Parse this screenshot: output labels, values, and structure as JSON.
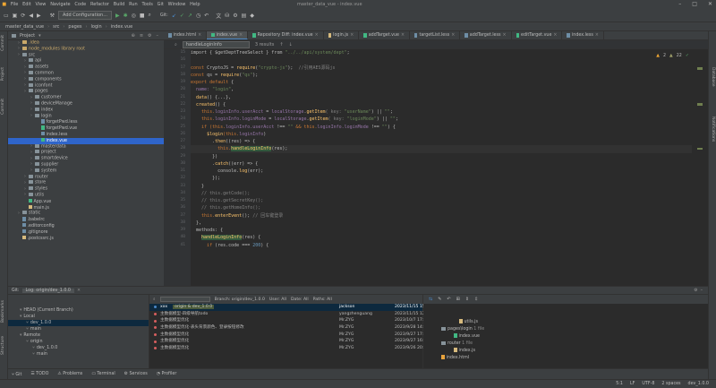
{
  "menu": [
    "File",
    "Edit",
    "View",
    "Navigate",
    "Code",
    "Refactor",
    "Build",
    "Run",
    "Tools",
    "Git",
    "Window",
    "Help"
  ],
  "window_title": "master_data_vue - index.vue",
  "toolbar": {
    "config_label": "Add Configuration...",
    "git_label": "Git:"
  },
  "breadcrumbs": [
    "master_data_vue",
    "src",
    "pages",
    "login",
    "index.vue"
  ],
  "project": {
    "header": "Project",
    "tree": [
      {
        "label": ".idea",
        "depth": 1,
        "kind": "folder",
        "color": "orange"
      },
      {
        "label": "node_modules library root",
        "depth": 1,
        "kind": "folder",
        "color": "orange"
      },
      {
        "label": "src",
        "depth": 1,
        "kind": "folder"
      },
      {
        "label": "api",
        "depth": 2,
        "kind": "folder"
      },
      {
        "label": "assets",
        "depth": 2,
        "kind": "folder"
      },
      {
        "label": "common",
        "depth": 2,
        "kind": "folder"
      },
      {
        "label": "components",
        "depth": 2,
        "kind": "folder"
      },
      {
        "label": "iconfont",
        "depth": 2,
        "kind": "folder"
      },
      {
        "label": "pages",
        "depth": 2,
        "kind": "folder"
      },
      {
        "label": "customer",
        "depth": 3,
        "kind": "folder"
      },
      {
        "label": "deviceManage",
        "depth": 3,
        "kind": "folder"
      },
      {
        "label": "index",
        "depth": 3,
        "kind": "folder"
      },
      {
        "label": "login",
        "depth": 3,
        "kind": "folder"
      },
      {
        "label": "forgetPwd.less",
        "depth": 4,
        "kind": "file"
      },
      {
        "label": "forgetPwd.vue",
        "depth": 4,
        "kind": "vue"
      },
      {
        "label": "index.less",
        "depth": 4,
        "kind": "file"
      },
      {
        "label": "index.vue",
        "depth": 4,
        "kind": "vue",
        "selected": true
      },
      {
        "label": "masterdata",
        "depth": 3,
        "kind": "folder"
      },
      {
        "label": "project",
        "depth": 3,
        "kind": "folder"
      },
      {
        "label": "smartdevice",
        "depth": 3,
        "kind": "folder"
      },
      {
        "label": "supplier",
        "depth": 3,
        "kind": "folder"
      },
      {
        "label": "system",
        "depth": 3,
        "kind": "folder"
      },
      {
        "label": "router",
        "depth": 2,
        "kind": "folder"
      },
      {
        "label": "store",
        "depth": 2,
        "kind": "folder"
      },
      {
        "label": "styles",
        "depth": 2,
        "kind": "folder"
      },
      {
        "label": "utils",
        "depth": 2,
        "kind": "folder"
      },
      {
        "label": "App.vue",
        "depth": 2,
        "kind": "vue"
      },
      {
        "label": "main.js",
        "depth": 2,
        "kind": "js"
      },
      {
        "label": "static",
        "depth": 1,
        "kind": "folder"
      },
      {
        "label": ".babelrc",
        "depth": 1,
        "kind": "file"
      },
      {
        "label": ".editorconfig",
        "depth": 1,
        "kind": "file"
      },
      {
        "label": ".gitignore",
        "depth": 1,
        "kind": "file"
      },
      {
        "label": ".postcssrc.js",
        "depth": 1,
        "kind": "js"
      }
    ]
  },
  "tabs": [
    {
      "label": "index.html"
    },
    {
      "label": "index.vue",
      "active": true
    },
    {
      "label": "Repository Diff: index.vue"
    },
    {
      "label": "login.js"
    },
    {
      "label": "addTarget.vue"
    },
    {
      "label": "targetList.less"
    },
    {
      "label": "addTarget.less"
    },
    {
      "label": "editTarget.vue"
    },
    {
      "label": "index.less"
    }
  ],
  "subbar": {
    "search": "handleLoginInfo",
    "results": "3 results"
  },
  "inspections": {
    "warnings": "2",
    "weak": "22",
    "ok": "17"
  },
  "code_lines": [
    [
      [
        "import { ",
        "t"
      ],
      [
        "$getDeptTreeSelect",
        "t"
      ],
      [
        " } from ",
        "t"
      ],
      [
        "\"../../api/system/dept\"",
        "s"
      ],
      [
        ";",
        "t"
      ]
    ],
    [],
    [
      [
        "const ",
        "k"
      ],
      [
        "CryptoJS",
        "t"
      ],
      [
        " = ",
        "t"
      ],
      [
        "require",
        "f"
      ],
      [
        "(",
        "t"
      ],
      [
        "\"crypto-js\"",
        "s"
      ],
      [
        ");  ",
        "t"
      ],
      [
        "//引用AES源码js",
        "c"
      ]
    ],
    [
      [
        "const ",
        "k"
      ],
      [
        "qs",
        "t"
      ],
      [
        " = ",
        "t"
      ],
      [
        "require",
        "f"
      ],
      [
        "(",
        "t"
      ],
      [
        "\"qs\"",
        "s"
      ],
      [
        ");",
        "t"
      ]
    ],
    [
      [
        "export default ",
        "k"
      ],
      [
        "{",
        "t"
      ]
    ],
    [
      [
        "  name: ",
        "p"
      ],
      [
        "\"login\"",
        "s"
      ],
      [
        ",",
        "t"
      ]
    ],
    [
      [
        "  ",
        "t"
      ],
      [
        "data",
        "f"
      ],
      [
        "() ",
        "t"
      ],
      [
        "{...}",
        "t"
      ],
      [
        ",",
        "t"
      ]
    ],
    [
      [
        "  ",
        "t"
      ],
      [
        "created",
        "f"
      ],
      [
        "() {",
        "t"
      ]
    ],
    [
      [
        "    this.",
        "k"
      ],
      [
        "loginInfo.userAcct",
        "p"
      ],
      [
        " = ",
        "t"
      ],
      [
        "localStorage",
        "p"
      ],
      [
        ".",
        "t"
      ],
      [
        "getItem",
        "f"
      ],
      [
        "( key: ",
        "c"
      ],
      [
        "\"userName\"",
        "s"
      ],
      [
        ") || ",
        "t"
      ],
      [
        "\"\"",
        "s"
      ],
      [
        ";",
        "t"
      ]
    ],
    [
      [
        "    this.",
        "k"
      ],
      [
        "loginInfo.loginMode",
        "p"
      ],
      [
        " = ",
        "t"
      ],
      [
        "localStorage",
        "p"
      ],
      [
        ".",
        "t"
      ],
      [
        "getItem",
        "f"
      ],
      [
        "( key: ",
        "c"
      ],
      [
        "\"loginMode\"",
        "s"
      ],
      [
        ") || ",
        "t"
      ],
      [
        "\"\"",
        "s"
      ],
      [
        ";",
        "t"
      ]
    ],
    [
      [
        "    if ",
        "k"
      ],
      [
        "(this.",
        "k"
      ],
      [
        "loginInfo.userAcct",
        "p"
      ],
      [
        " !== ",
        "t"
      ],
      [
        "\"\"",
        "s"
      ],
      [
        " && this.",
        "k"
      ],
      [
        "loginInfo.loginMode",
        "p"
      ],
      [
        " !== ",
        "t"
      ],
      [
        "\"\"",
        "s"
      ],
      [
        ") {",
        "t"
      ]
    ],
    [
      [
        "      ",
        "t"
      ],
      [
        "$login",
        "f"
      ],
      [
        "(this.",
        "k"
      ],
      [
        "loginInfo",
        "p"
      ],
      [
        ")",
        "t"
      ]
    ],
    [
      [
        "        .",
        "t"
      ],
      [
        "then",
        "f"
      ],
      [
        "((res) => {",
        "t"
      ]
    ],
    [
      [
        "          this.",
        "k"
      ],
      [
        "handleLoginInfo",
        "m"
      ],
      [
        "(res);",
        "t"
      ]
    ],
    [
      [
        "        })",
        "t"
      ]
    ],
    [
      [
        "        .",
        "t"
      ],
      [
        "catch",
        "f"
      ],
      [
        "((err) => {",
        "t"
      ]
    ],
    [
      [
        "          console.",
        "t"
      ],
      [
        "log",
        "f"
      ],
      [
        "(err);",
        "t"
      ]
    ],
    [
      [
        "        });",
        "t"
      ]
    ],
    [
      [
        "    }",
        "t"
      ]
    ],
    [
      [
        "    ",
        "t"
      ],
      [
        "// this.getCode();",
        "c"
      ]
    ],
    [
      [
        "    ",
        "t"
      ],
      [
        "// this.getSecretKey();",
        "c"
      ]
    ],
    [
      [
        "    ",
        "t"
      ],
      [
        "// this.getHomeInfo();",
        "c"
      ]
    ],
    [
      [
        "    this.",
        "k"
      ],
      [
        "enterEvent",
        "f"
      ],
      [
        "(); ",
        "t"
      ],
      [
        "// 回车键登录",
        "c"
      ]
    ],
    [
      [
        "  },",
        "t"
      ]
    ],
    [
      [
        "  methods: {",
        "t"
      ]
    ],
    [
      [
        "    ",
        "t"
      ],
      [
        "handleLoginInfo",
        "m"
      ],
      [
        "(res) {",
        "t"
      ]
    ],
    [
      [
        "      if ",
        "k"
      ],
      [
        "(res.code === ",
        "t"
      ],
      [
        "200",
        "n"
      ],
      [
        ") {",
        "t"
      ]
    ]
  ],
  "first_line_number": 15,
  "git": {
    "header": "Git:",
    "tab": "Log: origin/dev_1.0.0",
    "branches": [
      {
        "label": "HEAD (Current Branch)",
        "depth": 1
      },
      {
        "label": "Local",
        "depth": 1
      },
      {
        "label": "dev_1.0.0",
        "depth": 2,
        "selected": true
      },
      {
        "label": "main",
        "depth": 2
      },
      {
        "label": "Remote",
        "depth": 1
      },
      {
        "label": "origin",
        "depth": 2
      },
      {
        "label": "dev_1.0.0",
        "depth": 3
      },
      {
        "label": "main",
        "depth": 3
      }
    ],
    "log_bar": {
      "branch": "Branch: origin/dev_1.0.0",
      "user": "User: All",
      "date": "Date: All",
      "paths": "Paths: All"
    },
    "commits": [
      {
        "msg": "xxx",
        "badge": "origin & dev_1.0.0",
        "author": "jackson",
        "date": "2023/11/15 15:38",
        "color": "#4a88c7",
        "selected": true
      },
      {
        "msg": "主数据模型-四级导航todo",
        "author": "yangzhenguang",
        "date": "2023/11/15 12:34",
        "color": "#d75f5f"
      },
      {
        "msg": "主数据模型优化",
        "author": "Mr.ZYG",
        "date": "2023/10/7 17:17",
        "color": "#d75f5f"
      },
      {
        "msg": "主数据模型优化-表头背景颜色、登录按钮修改",
        "author": "Mr.ZYG",
        "date": "2023/9/28 14:14",
        "color": "#d75f5f"
      },
      {
        "msg": "主数据模型优化",
        "author": "Mr.ZYG",
        "date": "2023/9/27 17:05",
        "color": "#d75f5f"
      },
      {
        "msg": "主数据模型优化",
        "author": "Mr.ZYG",
        "date": "2023/9/27 16:55",
        "color": "#d75f5f"
      },
      {
        "msg": "主数据模型优化",
        "author": "Mr.ZYG",
        "date": "2023/9/26 20:08",
        "color": "#d75f5f"
      }
    ],
    "changes": [
      {
        "label": "utils.js",
        "kind": "js",
        "x": 40,
        "y": 27
      },
      {
        "label": "pages\\login",
        "extra": "1 file",
        "kind": "folder",
        "x": 20,
        "y": 35
      },
      {
        "label": "index.vue",
        "kind": "vue",
        "x": 34,
        "y": 43
      },
      {
        "label": "router",
        "extra": "1 file",
        "kind": "folder",
        "x": 20,
        "y": 51
      },
      {
        "label": "index.js",
        "kind": "js",
        "x": 34,
        "y": 59
      },
      {
        "label": "index.html",
        "kind": "file",
        "x": 20,
        "y": 67
      },
      {
        "label": "xxx",
        "kind": "text",
        "x": 6,
        "y": 85
      }
    ]
  },
  "bottom_tabs": [
    "Git",
    "TODO",
    "Problems",
    "Terminal",
    "Services",
    "Profiler"
  ],
  "status": [
    "5:1",
    "LF",
    "UTF-8",
    "2 spaces",
    "dev_1.0.0"
  ]
}
